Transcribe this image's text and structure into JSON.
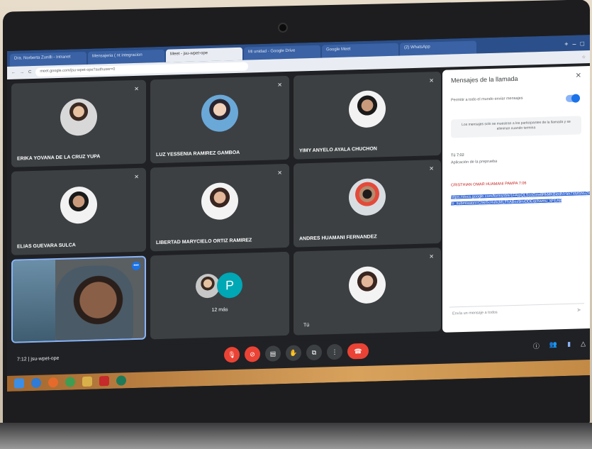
{
  "browser": {
    "tabs": [
      {
        "label": "Dra. Norberta Zunilli - Intranet"
      },
      {
        "label": "Mensajeria ( nt integracion"
      },
      {
        "label": "Meet - jsu-wpet-ope"
      },
      {
        "label": "Mi unidad - Google Drive"
      },
      {
        "label": "Google Meet"
      },
      {
        "label": "(2) WhatsApp"
      }
    ],
    "url": "meet.google.com/jsu-wpet-ope?authuser=0"
  },
  "participants": [
    {
      "name": "ERIKA YOVANA DE LA CRUZ YUPA",
      "avatar": "woman-avatar"
    },
    {
      "name": "LUZ YESSENIA RAMIREZ GAMBOA",
      "avatar": "woman-avatar"
    },
    {
      "name": "YIMY ANYELO AYALA CHUCHON",
      "avatar": "man-avatar"
    },
    {
      "name": "ELIAS GUEVARA SULCA",
      "avatar": "man-avatar"
    },
    {
      "name": "LIBERTAD MARYCIELO ORTIZ RAMIREZ",
      "avatar": "woman-avatar"
    },
    {
      "name": "ANDRES HUAMANI FERNANDEZ",
      "avatar": "man-masked-avatar"
    }
  ],
  "more_tile": {
    "initial": "P",
    "label": "12 más"
  },
  "self_tile": {
    "label": "Tú"
  },
  "chat": {
    "title": "Mensajes de la llamada",
    "toggle_label": "Permitir a todo el mundo enviar mensajes",
    "notice": "Los mensajes solo se muestran a los participantes de la llamada y se eliminan cuando termina",
    "msg1_meta": "Tú  7:02",
    "msg1_text": "Aplicación de la prepruebа",
    "msg2_meta": "CRISTHIAN OMAR HUAMANI PAMPA  7:06",
    "msg2_link": "https://docs.google.com/forms/d/e/1FAIpQLScoDzw8RkMKBiedNYkh7XMSNvZheEAd4MrfwROVJL0uLhsuA/viewform?fe_submission=ChkI5cHxhcMLFhABoz9nvDDEqchwmu_kFEAB",
    "input_placeholder": "Envía un mensaje a todos"
  },
  "meeting": {
    "time": "7:12",
    "code": "jsu-wpet-ope"
  },
  "colors": {
    "hangup": "#ea4335",
    "accent": "#1a73e8",
    "panel": "#ffffff",
    "tile": "#3c4043"
  }
}
